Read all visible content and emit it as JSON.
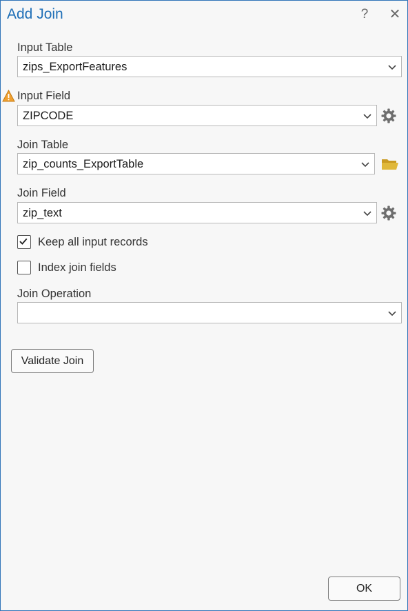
{
  "dialog": {
    "title": "Add Join",
    "help_glyph": "?",
    "close_glyph": "✕"
  },
  "input_table": {
    "label": "Input Table",
    "value": "zips_ExportFeatures"
  },
  "input_field": {
    "label": "Input Field",
    "value": "ZIPCODE",
    "warning_icon": "warning-icon",
    "side_icon": "gear-icon"
  },
  "join_table": {
    "label": "Join Table",
    "value": "zip_counts_ExportTable",
    "side_icon": "folder-icon"
  },
  "join_field": {
    "label": "Join Field",
    "value": "zip_text",
    "side_icon": "gear-icon"
  },
  "keep_all": {
    "label": "Keep all input records",
    "checked": true
  },
  "index_join": {
    "label": "Index join fields",
    "checked": false
  },
  "join_operation": {
    "label": "Join Operation",
    "value": ""
  },
  "buttons": {
    "validate": "Validate Join",
    "ok": "OK"
  },
  "colors": {
    "title": "#1f6fb7",
    "border": "#2f73b8",
    "folder": "#e0b83a",
    "warning": "#f0a030"
  }
}
